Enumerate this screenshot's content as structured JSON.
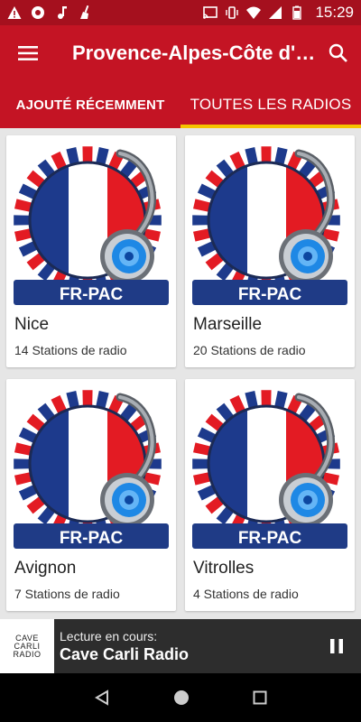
{
  "status_bar": {
    "time": "15:29",
    "left_icons": [
      "warning-icon",
      "aperture-icon",
      "music-note-icon",
      "broom-icon"
    ],
    "right_icons": [
      "cast-icon",
      "vibrate-icon",
      "wifi-icon",
      "signal-icon",
      "battery-icon"
    ]
  },
  "app_bar": {
    "title": "Provence-Alpes-Côte d'Azur",
    "menu_icon": "hamburger-menu-icon",
    "search_icon": "search-icon"
  },
  "tabs": [
    {
      "label": "AJOUTÉ RÉCEMMENT",
      "active": false
    },
    {
      "label": "TOUTES LES RADIOS",
      "active": true
    }
  ],
  "cards": [
    {
      "image_label": "FR-PAC",
      "city": "Nice",
      "count": "14 Stations de radio"
    },
    {
      "image_label": "FR-PAC",
      "city": "Marseille",
      "count": "20 Stations de radio"
    },
    {
      "image_label": "FR-PAC",
      "city": "Avignon",
      "count": "7 Stations de radio"
    },
    {
      "image_label": "FR-PAC",
      "city": "Vitrolles",
      "count": "4 Stations de radio"
    }
  ],
  "player": {
    "logo_lines": [
      "CAVE",
      "CARLI",
      "RADIO"
    ],
    "label": "Lecture en cours:",
    "station": "Cave Carli Radio",
    "pause_icon": "pause-icon"
  },
  "nav": [
    "back-icon",
    "home-icon",
    "recents-icon"
  ],
  "colors": {
    "status_bar": "#a5101e",
    "app_bar": "#c41424",
    "tab_indicator": "#f5c400",
    "player_bg": "#2d2d2d",
    "flag_blue": "#1d3a8c",
    "flag_red": "#e31b23"
  }
}
